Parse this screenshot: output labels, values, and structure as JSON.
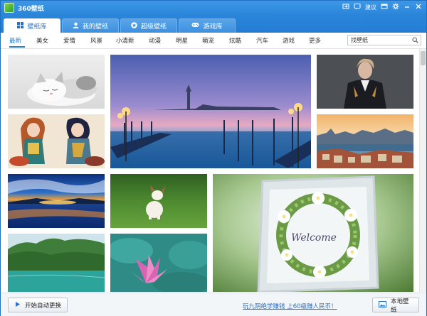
{
  "app": {
    "title": "360壁纸"
  },
  "titlebar": {
    "feedback_label": "建议"
  },
  "tabs": [
    {
      "label": "壁纸库",
      "icon": "grid-icon"
    },
    {
      "label": "我的壁纸",
      "icon": "user-icon"
    },
    {
      "label": "超级壁纸",
      "icon": "star-icon"
    },
    {
      "label": "游戏库",
      "icon": "gamepad-icon"
    }
  ],
  "categories": [
    "最新",
    "美女",
    "爱情",
    "风景",
    "小清新",
    "动漫",
    "明星",
    "萌宠",
    "炫酷",
    "汽车",
    "游戏",
    "更多"
  ],
  "search": {
    "value": "找壁纸",
    "placeholder": "找壁纸"
  },
  "wallpapers": [
    {
      "subject": "sleeping-kitten"
    },
    {
      "subject": "venice-dusk-gondolas"
    },
    {
      "subject": "man-in-dark-coat"
    },
    {
      "subject": "anime-drummers"
    },
    {
      "subject": "city-skyline-river"
    },
    {
      "subject": "sunset-lake"
    },
    {
      "subject": "dog-on-grass"
    },
    {
      "subject": "welcome-flower-wreath"
    },
    {
      "subject": "green-mountain-lake"
    },
    {
      "subject": "pink-lotus"
    }
  ],
  "wreath_text": "Welcome",
  "footer": {
    "auto_change_label": "开始自动更换",
    "promo_text": "玩九阴绝学赚钱 上60级赚人民币！",
    "local_wallpaper_label": "本地壁纸"
  },
  "colors": {
    "accent": "#2b86da",
    "active_tab_text": "#2a73c4",
    "link": "#2a6fc4"
  }
}
